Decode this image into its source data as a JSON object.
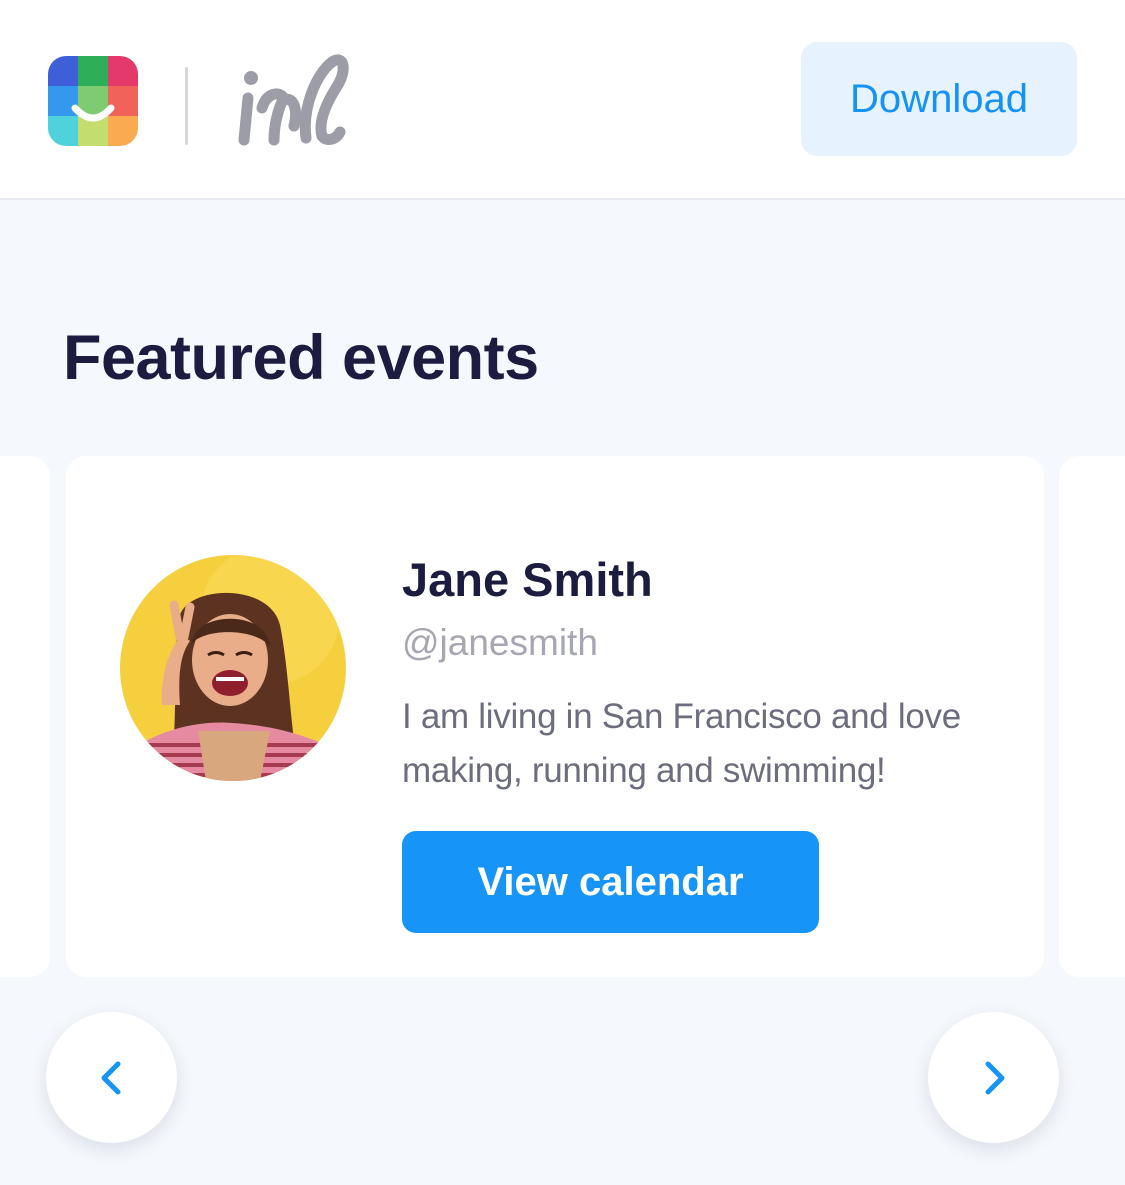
{
  "header": {
    "logo_icon": "app-logo-icon",
    "brand_mark_icon": "irl-wordmark-icon",
    "download_label": "Download"
  },
  "colors": {
    "accent": "#1694f7",
    "accent_light": "#e6f2fd",
    "title_text": "#1b1c3f",
    "muted_text": "#a6a7b2",
    "body_text": "#6c6d7f",
    "page_background": "#f5f8fc"
  },
  "featured": {
    "title": "Featured events",
    "profile": {
      "name": "Jane Smith",
      "handle": "@janesmith",
      "bio": "I am living in San Francisco and love making, running and swimming!",
      "button_label": "View calendar",
      "avatar_icon": "profile-photo"
    },
    "navigation": {
      "prev_icon": "chevron-left-icon",
      "next_icon": "chevron-right-icon"
    }
  }
}
